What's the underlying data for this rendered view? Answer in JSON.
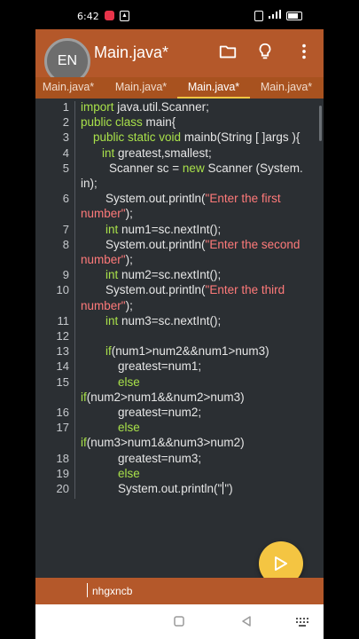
{
  "status_bar": {
    "time": "6:42"
  },
  "toolbar": {
    "badge": "EN",
    "title": "Main.java*",
    "icons": [
      "folder-icon",
      "lightbulb-icon",
      "more-vert-icon"
    ]
  },
  "tabs": [
    {
      "label": "Main.java*",
      "active": false
    },
    {
      "label": "Main.java*",
      "active": false
    },
    {
      "label": "Main.java*",
      "active": true
    },
    {
      "label": "Main.java*",
      "active": false
    }
  ],
  "editor": {
    "lines": [
      {
        "n": "1",
        "parts": [
          [
            "kw",
            "import"
          ],
          [
            "t",
            " java.util.Scanner;"
          ]
        ],
        "indent": 0
      },
      {
        "n": "2",
        "parts": [
          [
            "kw",
            "public class"
          ],
          [
            "t",
            " main{"
          ]
        ],
        "indent": 0
      },
      {
        "n": "3",
        "parts": [
          [
            "kw",
            "public static void"
          ],
          [
            "t",
            " mainb(String [ ]args ){"
          ]
        ],
        "indent": 14
      },
      {
        "n": "4",
        "parts": [
          [
            "kw",
            "int"
          ],
          [
            "t",
            " greatest,smallest;"
          ]
        ],
        "indent": 24
      },
      {
        "n": "5",
        "parts": [
          [
            "t",
            "Scanner sc = "
          ],
          [
            "kw",
            "new"
          ],
          [
            "t",
            " Scanner (System."
          ]
        ],
        "indent": 32
      },
      {
        "n": "",
        "parts": [
          [
            "t",
            "in);"
          ]
        ],
        "indent": 0
      },
      {
        "n": "6",
        "parts": [
          [
            "t",
            "System.out.println("
          ],
          [
            "str",
            "\"Enter the first"
          ]
        ],
        "indent": 28
      },
      {
        "n": "",
        "parts": [
          [
            "str",
            "number\""
          ],
          [
            "t",
            ");"
          ]
        ],
        "indent": 0
      },
      {
        "n": "7",
        "parts": [
          [
            "kw",
            "int"
          ],
          [
            "t",
            " num1=sc.nextInt();"
          ]
        ],
        "indent": 28
      },
      {
        "n": "8",
        "parts": [
          [
            "t",
            "System.out.println("
          ],
          [
            "str",
            "\"Enter the second"
          ]
        ],
        "indent": 28
      },
      {
        "n": "",
        "parts": [
          [
            "str",
            "number\""
          ],
          [
            "t",
            ");"
          ]
        ],
        "indent": 0
      },
      {
        "n": "9",
        "parts": [
          [
            "kw",
            "int"
          ],
          [
            "t",
            " num2=sc.nextInt();"
          ]
        ],
        "indent": 28
      },
      {
        "n": "10",
        "parts": [
          [
            "t",
            "System.out.println("
          ],
          [
            "str",
            "\"Enter the third"
          ]
        ],
        "indent": 28
      },
      {
        "n": "",
        "parts": [
          [
            "str",
            "number\""
          ],
          [
            "t",
            ");"
          ]
        ],
        "indent": 0
      },
      {
        "n": "11",
        "parts": [
          [
            "kw",
            "int"
          ],
          [
            "t",
            " num3=sc.nextInt();"
          ]
        ],
        "indent": 28
      },
      {
        "n": "12",
        "parts": [],
        "indent": 0
      },
      {
        "n": "13",
        "parts": [
          [
            "kw",
            "if"
          ],
          [
            "t",
            "(num1>num2&&num1>num3)"
          ]
        ],
        "indent": 28
      },
      {
        "n": "14",
        "parts": [
          [
            "t",
            "greatest=num1;"
          ]
        ],
        "indent": 42
      },
      {
        "n": "15",
        "parts": [
          [
            "kw",
            "else"
          ]
        ],
        "indent": 42
      },
      {
        "n": "",
        "parts": [
          [
            "kw",
            "if"
          ],
          [
            "t",
            "(num2>num1&&num2>num3)"
          ]
        ],
        "indent": 0
      },
      {
        "n": "16",
        "parts": [
          [
            "t",
            "greatest=num2;"
          ]
        ],
        "indent": 42
      },
      {
        "n": "17",
        "parts": [
          [
            "kw",
            "else"
          ]
        ],
        "indent": 42
      },
      {
        "n": "",
        "parts": [
          [
            "kw",
            "if"
          ],
          [
            "t",
            "(num3>num1&&num3>num2)"
          ]
        ],
        "indent": 0
      },
      {
        "n": "18",
        "parts": [
          [
            "t",
            "greatest=num3;"
          ]
        ],
        "indent": 42
      },
      {
        "n": "19",
        "parts": [
          [
            "kw",
            "else"
          ]
        ],
        "indent": 42
      },
      {
        "n": "20",
        "parts": [
          [
            "t",
            "System.out.println(\""
          ],
          [
            "cursor",
            ""
          ],
          [
            "t",
            "\")"
          ]
        ],
        "indent": 42
      }
    ]
  },
  "fab": {
    "icon": "play-icon"
  },
  "input_bar": {
    "text": "nhgxncb"
  },
  "nav_bar": {
    "icons": [
      "square-icon",
      "back-triangle-icon",
      "keyboard-icon"
    ]
  },
  "colors": {
    "toolbar": "#b4582a",
    "tabs": "#a8521f",
    "editor_bg": "#2b2f33",
    "keyword": "#a8e04a",
    "string": "#ff7a7a",
    "fab": "#f4c542",
    "active_tab_indicator": "#f4c542"
  }
}
